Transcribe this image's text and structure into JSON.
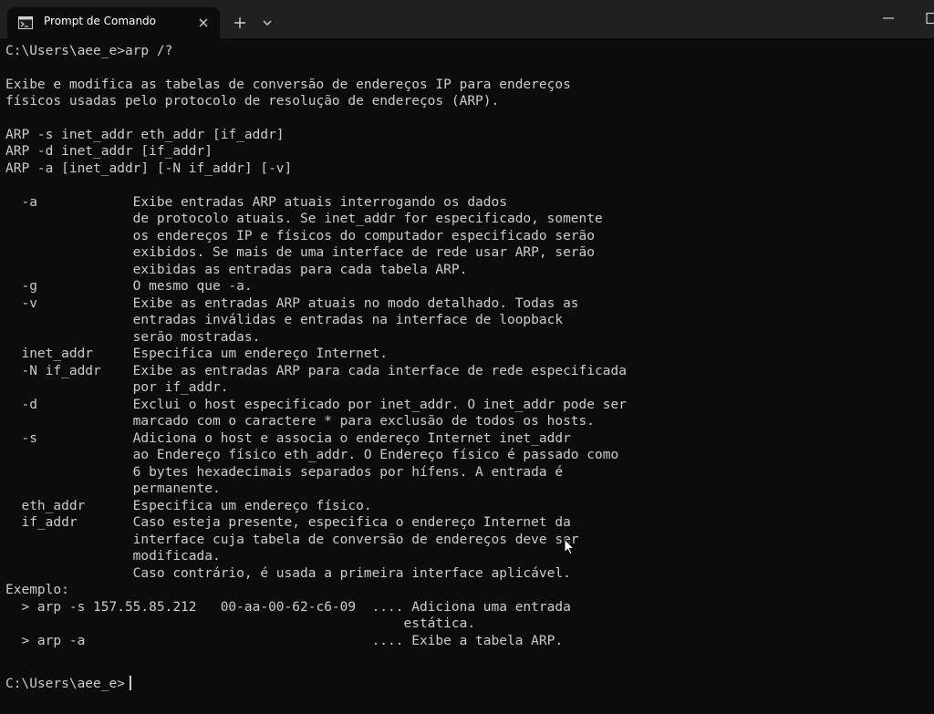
{
  "window": {
    "tab_title": "Prompt de Comando",
    "tab_icon": "terminal-icon",
    "close_icon": "close-icon",
    "new_tab_icon": "plus-icon",
    "dropdown_icon": "chevron-down-icon",
    "minimize_icon": "minimize-icon",
    "maximize_icon": "maximize-icon"
  },
  "colors": {
    "background": "#0c0c0c",
    "titlebar": "#202020",
    "text": "#cccccc"
  },
  "terminal": {
    "lines": [
      "C:\\Users\\aee_e>arp /?",
      "",
      "Exibe e modifica as tabelas de conversão de endereços IP para endereços",
      "físicos usadas pelo protocolo de resolução de endereços (ARP).",
      "",
      "ARP -s inet_addr eth_addr [if_addr]",
      "ARP -d inet_addr [if_addr]",
      "ARP -a [inet_addr] [-N if_addr] [-v]",
      "",
      "  -a            Exibe entradas ARP atuais interrogando os dados",
      "                de protocolo atuais. Se inet_addr for especificado, somente",
      "                os endereços IP e físicos do computador especificado serão",
      "                exibidos. Se mais de uma interface de rede usar ARP, serão",
      "                exibidas as entradas para cada tabela ARP.",
      "  -g            O mesmo que -a.",
      "  -v            Exibe as entradas ARP atuais no modo detalhado. Todas as",
      "                entradas inválidas e entradas na interface de loopback",
      "                serão mostradas.",
      "  inet_addr     Especifica um endereço Internet.",
      "  -N if_addr    Exibe as entradas ARP para cada interface de rede especificada",
      "                por if_addr.",
      "  -d            Exclui o host especificado por inet_addr. O inet_addr pode ser",
      "                marcado com o caractere * para exclusão de todos os hosts.",
      "  -s            Adiciona o host e associa o endereço Internet inet_addr",
      "                ao Endereço físico eth_addr. O Endereço físico é passado como",
      "                6 bytes hexadecimais separados por hífens. A entrada é",
      "                permanente.",
      "  eth_addr      Especifica um endereço físico.",
      "  if_addr       Caso esteja presente, especifica o endereço Internet da",
      "                interface cuja tabela de conversão de endereços deve ser",
      "                modificada.",
      "                Caso contrário, é usada a primeira interface aplicável.",
      "Exemplo:",
      "  > arp -s 157.55.85.212   00-aa-00-62-c6-09  .... Adiciona uma entrada",
      "                                                  estática.",
      "  > arp -a                                    .... Exibe a tabela ARP.",
      "",
      "C:\\Users\\aee_e>"
    ]
  }
}
